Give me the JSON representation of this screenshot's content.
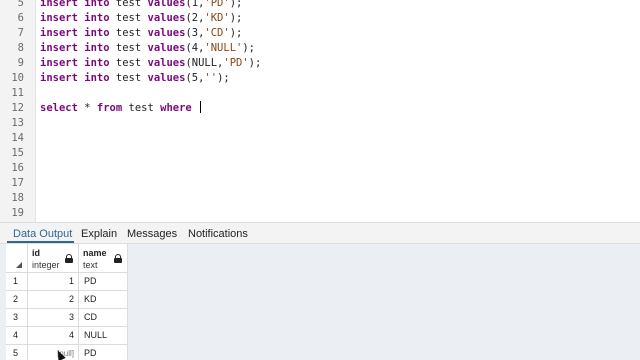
{
  "editor": {
    "lines": [
      {
        "num": "5",
        "parts": [
          [
            "kw",
            "insert"
          ],
          [
            "t",
            " "
          ],
          [
            "kw",
            "into"
          ],
          [
            "t",
            " test "
          ],
          [
            "kw",
            "values"
          ],
          [
            "t",
            "(1,"
          ],
          [
            "s",
            "'PD'"
          ],
          [
            "t",
            ");"
          ]
        ]
      },
      {
        "num": "6",
        "parts": [
          [
            "kw",
            "insert"
          ],
          [
            "t",
            " "
          ],
          [
            "kw",
            "into"
          ],
          [
            "t",
            " test "
          ],
          [
            "kw",
            "values"
          ],
          [
            "t",
            "(2,"
          ],
          [
            "s",
            "'KD'"
          ],
          [
            "t",
            ");"
          ]
        ]
      },
      {
        "num": "7",
        "parts": [
          [
            "kw",
            "insert"
          ],
          [
            "t",
            " "
          ],
          [
            "kw",
            "into"
          ],
          [
            "t",
            " test "
          ],
          [
            "kw",
            "values"
          ],
          [
            "t",
            "(3,"
          ],
          [
            "s",
            "'CD'"
          ],
          [
            "t",
            ");"
          ]
        ]
      },
      {
        "num": "8",
        "parts": [
          [
            "kw",
            "insert"
          ],
          [
            "t",
            " "
          ],
          [
            "kw",
            "into"
          ],
          [
            "t",
            " test "
          ],
          [
            "kw",
            "values"
          ],
          [
            "t",
            "(4,"
          ],
          [
            "s",
            "'NULL'"
          ],
          [
            "t",
            ");"
          ]
        ]
      },
      {
        "num": "9",
        "parts": [
          [
            "kw",
            "insert"
          ],
          [
            "t",
            " "
          ],
          [
            "kw",
            "into"
          ],
          [
            "t",
            " test "
          ],
          [
            "kw",
            "values"
          ],
          [
            "t",
            "(NULL,"
          ],
          [
            "s",
            "'PD'"
          ],
          [
            "t",
            ");"
          ]
        ]
      },
      {
        "num": "10",
        "parts": [
          [
            "kw",
            "insert"
          ],
          [
            "t",
            " "
          ],
          [
            "kw",
            "into"
          ],
          [
            "t",
            " test "
          ],
          [
            "kw",
            "values"
          ],
          [
            "t",
            "(5,"
          ],
          [
            "s",
            "''"
          ],
          [
            "t",
            ");"
          ]
        ]
      },
      {
        "num": "11",
        "parts": []
      },
      {
        "num": "12",
        "parts": [
          [
            "kw",
            "select"
          ],
          [
            "t",
            " * "
          ],
          [
            "kw",
            "from"
          ],
          [
            "t",
            " test "
          ],
          [
            "kw",
            "where"
          ],
          [
            "t",
            " "
          ]
        ],
        "cursor": true
      },
      {
        "num": "13",
        "parts": []
      },
      {
        "num": "14",
        "parts": []
      },
      {
        "num": "15",
        "parts": []
      },
      {
        "num": "16",
        "parts": []
      },
      {
        "num": "17",
        "parts": []
      },
      {
        "num": "18",
        "parts": []
      },
      {
        "num": "19",
        "parts": []
      }
    ]
  },
  "tabs": {
    "data_output": "Data Output",
    "explain": "Explain",
    "messages": "Messages",
    "notifications": "Notifications"
  },
  "grid": {
    "columns": [
      {
        "name": "id",
        "type": "integer"
      },
      {
        "name": "name",
        "type": "text"
      }
    ],
    "rows": [
      {
        "row": "1",
        "id": "1",
        "name": "PD"
      },
      {
        "row": "2",
        "id": "2",
        "name": "KD"
      },
      {
        "row": "3",
        "id": "3",
        "name": "CD"
      },
      {
        "row": "4",
        "id": "4",
        "name": "NULL"
      },
      {
        "row": "5",
        "id": "[null]",
        "name": "PD"
      }
    ]
  }
}
